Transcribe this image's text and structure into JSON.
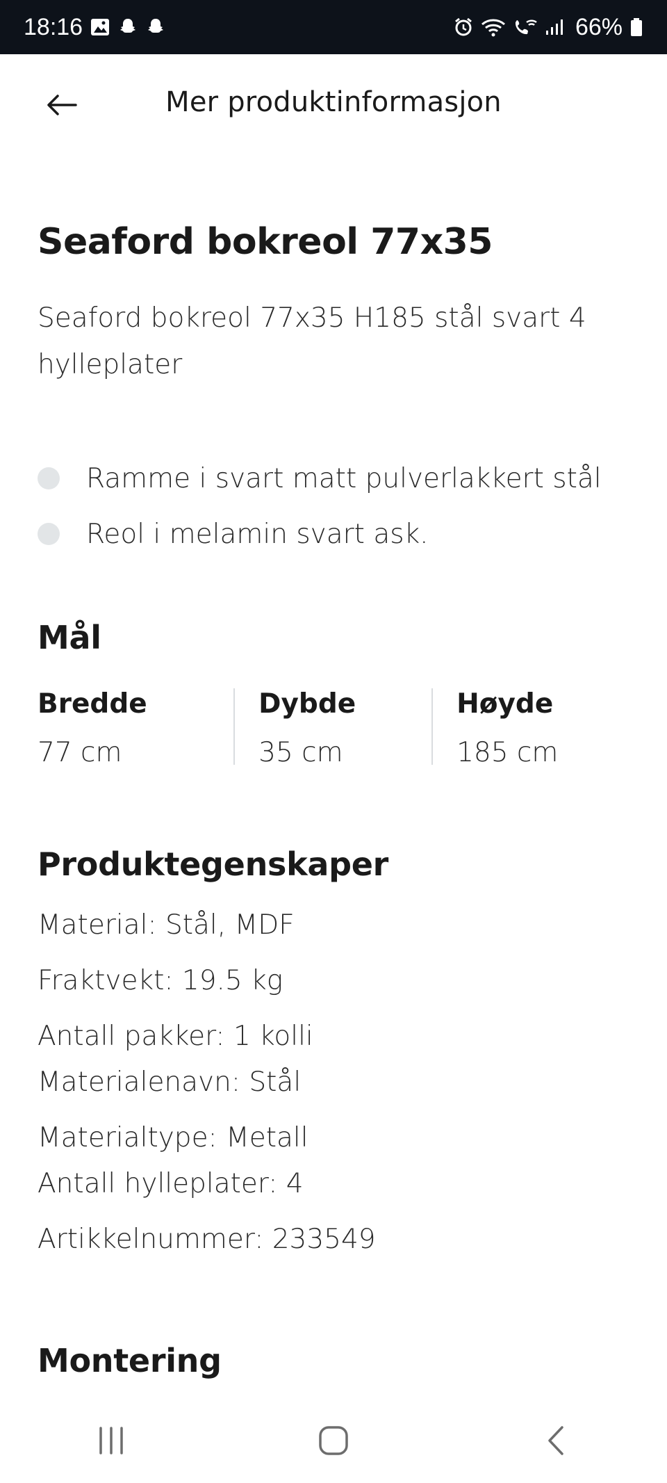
{
  "status_bar": {
    "time": "18:16",
    "battery": "66%",
    "left_icons": [
      "gallery-icon",
      "snapchat-icon",
      "snapchat-icon"
    ],
    "right_icons": [
      "alarm-icon",
      "wifi-icon",
      "wifi-calling-icon",
      "signal-icon",
      "battery-icon"
    ]
  },
  "app_bar": {
    "title": "Mer produktinformasjon",
    "back_icon": "back-arrow-icon"
  },
  "product": {
    "title": "Seaford bokreol 77x35",
    "description": "Seaford bokreol 77x35 H185 stål svart 4 hylleplater",
    "bullets": [
      "Ramme i svart matt pulverlakkert stål",
      "Reol i melamin svart ask."
    ]
  },
  "dimensions": {
    "title": "Mål",
    "items": [
      {
        "label": "Bredde",
        "value": "77 cm"
      },
      {
        "label": "Dybde",
        "value": "35 cm"
      },
      {
        "label": "Høyde",
        "value": "185 cm"
      }
    ]
  },
  "properties": {
    "title": "Produktegenskaper",
    "lines": [
      "Material: Stål, MDF",
      "Fraktvekt: 19.5 kg",
      "Antall pakker: 1 kolli",
      "Materialenavn: Stål",
      "Materialtype: Metall",
      "Antall hylleplater: 4",
      "Artikkelnummer: 233549"
    ]
  },
  "assembly": {
    "title": "Montering"
  },
  "nav_bar": {
    "icons": [
      "recent-apps-icon",
      "home-icon",
      "back-icon"
    ]
  }
}
